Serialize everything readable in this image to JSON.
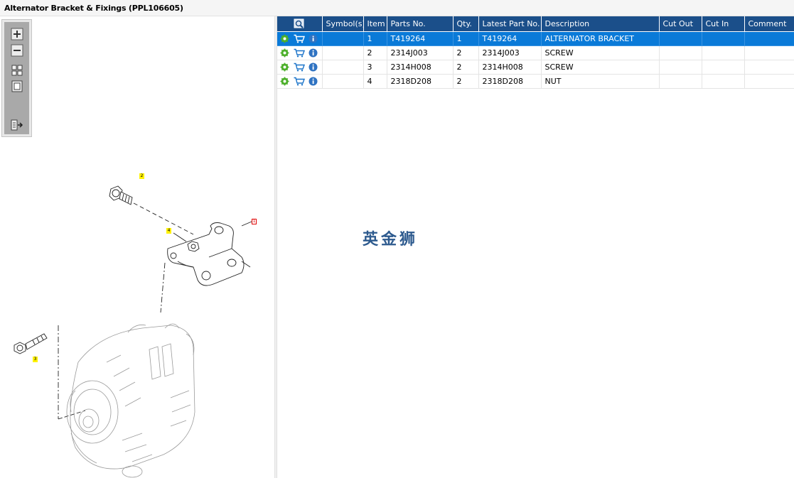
{
  "window": {
    "title": "Alternator Bracket & Fixings (PPL106605)"
  },
  "toolbar": {
    "buttons": [
      {
        "name": "zoom-in-button",
        "icon": "plus-icon"
      },
      {
        "name": "zoom-out-button",
        "icon": "minus-icon"
      },
      {
        "name": "fit-all-button",
        "icon": "grid-icon"
      },
      {
        "name": "actual-size-button",
        "icon": "square-icon"
      },
      {
        "name": "export-button",
        "icon": "export-icon"
      }
    ]
  },
  "diagram": {
    "callouts": [
      {
        "label": "2"
      },
      {
        "label": "1"
      },
      {
        "label": "4"
      },
      {
        "label": "3"
      }
    ]
  },
  "table": {
    "headers": {
      "symbols": "Symbol(s)",
      "item": "Item",
      "parts_no": "Parts No.",
      "qty": "Qty.",
      "latest_part_no": "Latest Part No.",
      "description": "Description",
      "cut_out": "Cut Out",
      "cut_in": "Cut In",
      "comment": "Comment"
    },
    "rows": [
      {
        "item": "1",
        "parts_no": "T419264",
        "qty": "1",
        "latest_part_no": "T419264",
        "description": "ALTERNATOR BRACKET",
        "cut_out": "",
        "cut_in": "",
        "comment": "",
        "selected": true
      },
      {
        "item": "2",
        "parts_no": "2314J003",
        "qty": "2",
        "latest_part_no": "2314J003",
        "description": "SCREW",
        "cut_out": "",
        "cut_in": "",
        "comment": "",
        "selected": false
      },
      {
        "item": "3",
        "parts_no": "2314H008",
        "qty": "2",
        "latest_part_no": "2314H008",
        "description": "SCREW",
        "cut_out": "",
        "cut_in": "",
        "comment": "",
        "selected": false
      },
      {
        "item": "4",
        "parts_no": "2318D208",
        "qty": "2",
        "latest_part_no": "2318D208",
        "description": "NUT",
        "cut_out": "",
        "cut_in": "",
        "comment": "",
        "selected": false
      }
    ]
  },
  "watermark": {
    "text": "英金狮"
  },
  "colors": {
    "header_bg": "#1b4f8a",
    "selected_row": "#0a7ad8",
    "callout_yellow": "#fff200",
    "callout_red": "#e00000"
  }
}
